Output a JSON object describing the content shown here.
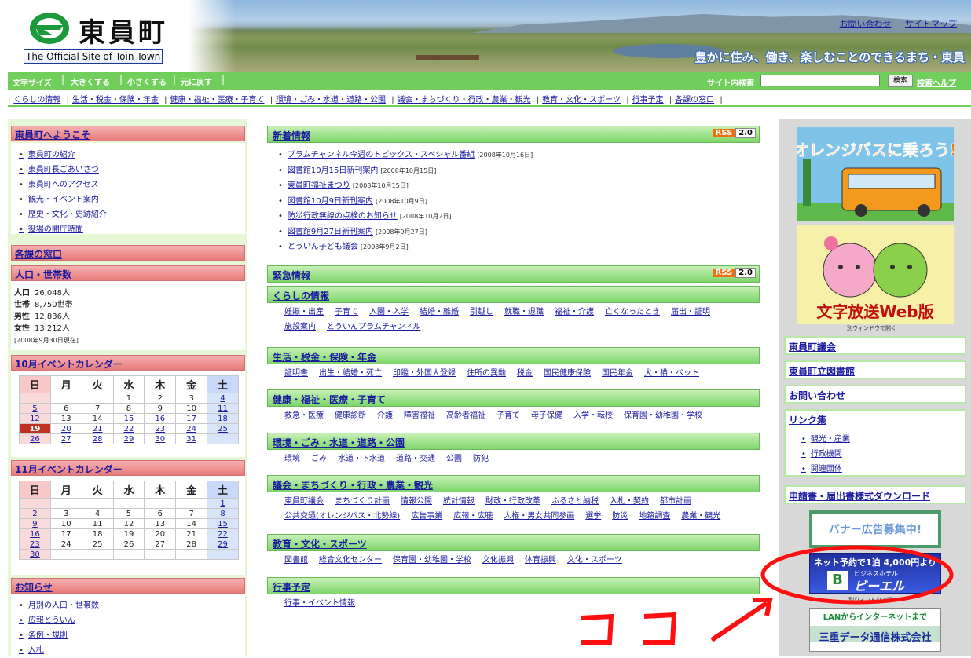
{
  "header": {
    "logo_jp": "東員町",
    "logo_en": "The Official Site of Toin Town",
    "tagline": "豊かに住み、働き、楽しむことのできるまち・東員",
    "links": [
      "お問い合わせ",
      "サイトマップ"
    ]
  },
  "sizebar": {
    "label": "文字サイズ",
    "buttons": [
      "大きくする",
      "小さくする",
      "元に戻す"
    ],
    "search_label": "サイト内検索",
    "search_value": "",
    "search_button": "検索",
    "help": "検索ヘルプ"
  },
  "nav": [
    "くらしの情報",
    "生活・税金・保険・年金",
    "健康・福祉・医療・子育て",
    "環境・ごみ・水道・道路・公園",
    "議会・まちづくり・行政・農業・観光",
    "教育・文化・スポーツ",
    "行事予定",
    "各課の窓口"
  ],
  "left": {
    "welcome": {
      "title": "東員町へようこそ",
      "items": [
        "東員町の紹介",
        "東員町長ごあいさつ",
        "東員町へのアクセス",
        "観光・イベント案内",
        "歴史・文化・史跡紹介",
        "役場の開庁時間"
      ]
    },
    "madoguchi": "各課の窓口",
    "population": {
      "title": "人口・世帯数",
      "rows": [
        [
          "人口",
          "26,048人"
        ],
        [
          "世帯",
          "8,750世帯"
        ],
        [
          "男性",
          "12,836人"
        ],
        [
          "女性",
          "13,212人"
        ]
      ],
      "note": "[2008年9月30日現在]"
    },
    "cal_oct": {
      "title": "10月イベントカレンダー",
      "head": [
        "日",
        "月",
        "火",
        "水",
        "木",
        "金",
        "土"
      ],
      "weeks": [
        [
          "",
          "",
          "",
          "1",
          "2",
          "3",
          "4"
        ],
        [
          "5",
          "6",
          "7",
          "8",
          "9",
          "10",
          "11"
        ],
        [
          "12",
          "13",
          "14",
          "15",
          "16",
          "17",
          "18"
        ],
        [
          "19",
          "20",
          "21",
          "22",
          "23",
          "24",
          "25"
        ],
        [
          "26",
          "27",
          "28",
          "29",
          "30",
          "31",
          ""
        ]
      ]
    },
    "cal_nov": {
      "title": "11月イベントカレンダー",
      "head": [
        "日",
        "月",
        "火",
        "水",
        "木",
        "金",
        "土"
      ],
      "weeks": [
        [
          "",
          "",
          "",
          "",
          "",
          "",
          "1"
        ],
        [
          "2",
          "3",
          "4",
          "5",
          "6",
          "7",
          "8"
        ],
        [
          "9",
          "10",
          "11",
          "12",
          "13",
          "14",
          "15"
        ],
        [
          "16",
          "17",
          "18",
          "19",
          "20",
          "21",
          "22"
        ],
        [
          "23",
          "24",
          "25",
          "26",
          "27",
          "28",
          "29"
        ],
        [
          "30",
          "",
          "",
          "",
          "",
          "",
          ""
        ]
      ]
    },
    "notice": {
      "title": "お知らせ",
      "items": [
        "月別の人口・世帯数",
        "広報とういん",
        "条例・規則",
        "入札"
      ]
    }
  },
  "center": {
    "news": {
      "title": "新着情報",
      "rss": "RSS",
      "rss_ver": "2.0",
      "items": [
        [
          "プラムチャンネル今週のトピックス・スペシャル番組",
          "[2008年10月16日]"
        ],
        [
          "図書館10月15日新刊案内",
          "[2008年10月15日]"
        ],
        [
          "東員町福祉まつり",
          "[2008年10月15日]"
        ],
        [
          "図書館10月9日新刊案内",
          "[2008年10月9日]"
        ],
        [
          "防災行政無線の点検のお知らせ",
          "[2008年10月2日]"
        ],
        [
          "図書館9月27日新刊案内",
          "[2008年9月27日]"
        ],
        [
          "とういん子ども議会",
          "[2008年9月2日]"
        ]
      ]
    },
    "emergency": {
      "title": "緊急情報",
      "rss": "RSS",
      "rss_ver": "2.0"
    },
    "sections": [
      {
        "title": "くらしの情報",
        "lines": [
          [
            "妊娠・出産",
            "子育て",
            "入園・入学",
            "結婚・離婚",
            "引越し",
            "就職・退職",
            "福祉・介護",
            "亡くなったとき",
            "届出・証明"
          ],
          [
            "施設案内",
            "とういんプラムチャンネル"
          ]
        ]
      },
      {
        "title": "生活・税金・保険・年金",
        "lines": [
          [
            "証明書",
            "出生・結婚・死亡",
            "印鑑・外国人登録",
            "住所の異動",
            "税金",
            "国民健康保険",
            "国民年金",
            "犬・猫・ペット"
          ]
        ]
      },
      {
        "title": "健康・福祉・医療・子育て",
        "lines": [
          [
            "救急・医療",
            "健康診断",
            "介護",
            "障害福祉",
            "高齢者福祉",
            "子育て",
            "母子保健",
            "入学・転校",
            "保育園・幼稚園・学校"
          ]
        ]
      },
      {
        "title": "環境・ごみ・水道・道路・公園",
        "lines": [
          [
            "環境",
            "ごみ",
            "水道・下水道",
            "道路・交通",
            "公園",
            "防犯"
          ]
        ]
      },
      {
        "title": "議会・まちづくり・行政・農業・観光",
        "lines": [
          [
            "東員町議会",
            "まちづくり計画",
            "情報公開",
            "統計情報",
            "財政・行政改革",
            "ふるさと納税",
            "入札・契約",
            "都市計画"
          ],
          [
            "公共交通(オレンジバス・北勢線)",
            "広告事業",
            "広報・広聴",
            "人権・男女共同参画",
            "選挙",
            "防災",
            "地籍調査",
            "農業・観光"
          ]
        ]
      },
      {
        "title": "教育・文化・スポーツ",
        "lines": [
          [
            "図書館",
            "総合文化センター",
            "保育園・幼稚園・学校",
            "文化振興",
            "体育振興",
            "文化・スポーツ"
          ]
        ]
      },
      {
        "title": "行事予定",
        "lines": [
          [
            "行事・イベント情報"
          ]
        ]
      }
    ]
  },
  "right": {
    "bus_banner": "オレンジバスに乗ろう!",
    "moji_banner": "文字放送Web版",
    "new_window": "別ウィンドウで開く",
    "boxes": [
      "東員町議会",
      "東員町立図書館",
      "お問い合わせ"
    ],
    "links": {
      "title": "リンク集",
      "items": [
        "観光・産業",
        "行政機関",
        "関連団体"
      ]
    },
    "download": "申請書・届出書様式ダウンロード",
    "ad_recruit": "バナー広告募集中!",
    "hotel_top": "ネット予約で1泊 4,000円より",
    "hotel_name": "ビーエル",
    "hotel_sub": "ビジネスホテル",
    "isp_top": "LANからインターネットまで",
    "isp_name": "三重データ通信株式会社",
    "annotation": "ココ",
    "colors": {
      "annotation": "#ff1010"
    }
  }
}
